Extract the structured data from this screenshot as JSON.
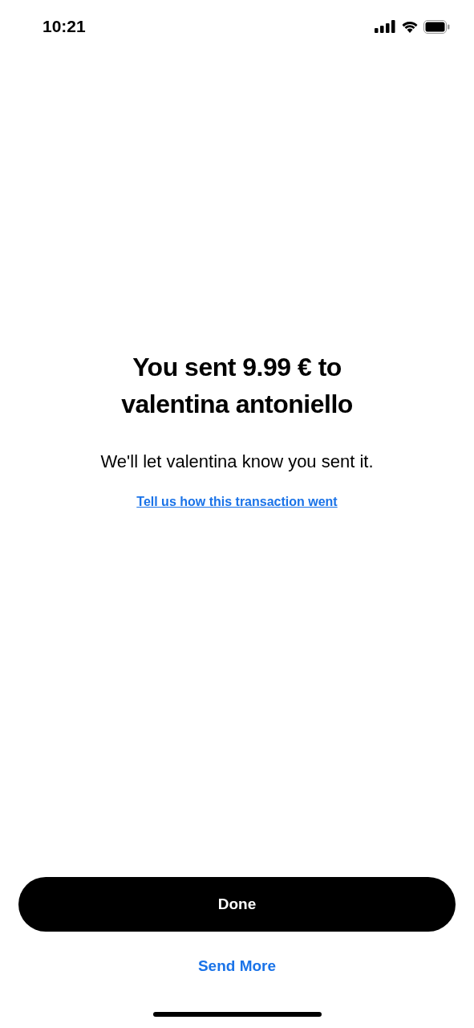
{
  "status_bar": {
    "time": "10:21"
  },
  "title": "You sent 9.99 € to valentina antoniello",
  "message": "We'll let valentina know you sent it.",
  "feedback_link": "Tell us how this transaction went",
  "buttons": [
    {
      "label": "Done",
      "kind": "primary"
    },
    {
      "label": "Send More",
      "kind": "text"
    }
  ]
}
